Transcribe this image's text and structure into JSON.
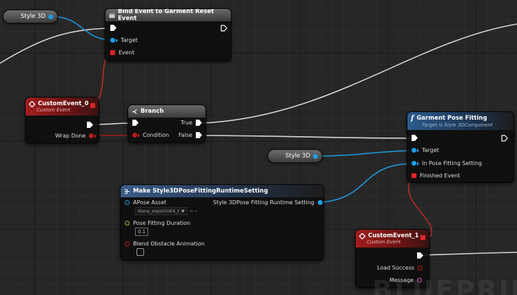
{
  "watermark": "BLUEPRINT",
  "nodes": {
    "style3d_top": {
      "label": "Style 3D"
    },
    "bind_event": {
      "title": "Bind Event to Garment Reset Event",
      "pins": {
        "target": "Target",
        "event": "Event"
      }
    },
    "custom_event_0": {
      "title": "CustomEvent_0",
      "subtitle": "Custom Event",
      "pins": {
        "wrap_done": "Wrap Done"
      }
    },
    "branch": {
      "title": "Branch",
      "pins": {
        "condition": "Condition",
        "true": "True",
        "false": "False"
      }
    },
    "garment_pose": {
      "title": "Garment Pose Fitting",
      "subtitle": "Target is Style 3DComponent",
      "pins": {
        "target": "Target",
        "in_pose": "In Pose Fitting Setting",
        "finished": "Finished Event"
      }
    },
    "style3d_mid": {
      "label": "Style 3D"
    },
    "make_setting": {
      "title": "Make Style3DPoseFittingRuntimeSetting",
      "pins": {
        "apose_asset": "APose Asset",
        "apose_value": "Nana_exportUE4_t",
        "output": "Style 3DPose Fitting Runtime Setting",
        "duration": "Pose Fitting Duration",
        "duration_value": "0.1",
        "blend": "Blend Obstacle Animation"
      }
    },
    "custom_event_1": {
      "title": "CustomEvent_1",
      "subtitle": "Custom Event",
      "pins": {
        "load_success": "Load Success",
        "message": "Message"
      }
    }
  },
  "colors": {
    "exec": "#ffffff",
    "object_pin": "#1e9ee8",
    "delegate_pin": "#e02424",
    "bool_pin": "#b81e1e",
    "float_pin": "#8ac43a",
    "string_pin": "#e043c8",
    "event_header": "#a11d1d",
    "function_header": "#2d5c8e"
  },
  "icons": {
    "function": "function-f-icon",
    "event": "event-diamond-icon",
    "branch": "branch-icon",
    "struct": "make-struct-icon",
    "bind": "bind-event-icon"
  }
}
